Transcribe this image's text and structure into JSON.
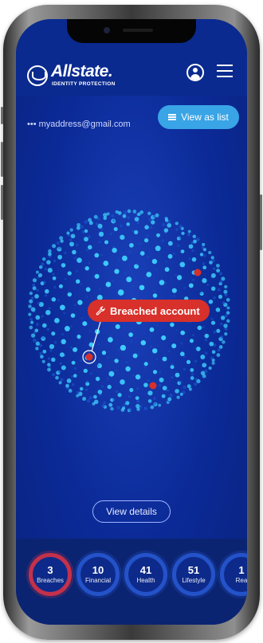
{
  "app": {
    "brand": "Allstate.",
    "brand_sub": "IDENTITY PROTECTION"
  },
  "header": {
    "profile_icon": "profile-icon",
    "menu_icon": "menu-icon"
  },
  "account": {
    "email": "••• myaddress@gmail.com"
  },
  "toolbar": {
    "view_as_list_label": "View as list",
    "view_as_list_icon": "list-icon"
  },
  "tooltip": {
    "label": "Breached account",
    "icon": "wrench-icon"
  },
  "actions": {
    "view_details_label": "View details"
  },
  "stats": [
    {
      "count": "3",
      "label": "Breaches",
      "ring": "red"
    },
    {
      "count": "10",
      "label": "Financial",
      "ring": "blue"
    },
    {
      "count": "41",
      "label": "Health",
      "ring": "blue"
    },
    {
      "count": "51",
      "label": "Lifestyle",
      "ring": "blue"
    },
    {
      "count": "1",
      "label": "Rea",
      "ring": "blue"
    }
  ],
  "colors": {
    "background": "#0b2a97",
    "accent_button": "#39a4e6",
    "alert": "#d8302a",
    "dot_light": "#3fd0ff",
    "dot_dark": "#1a5bd0"
  }
}
